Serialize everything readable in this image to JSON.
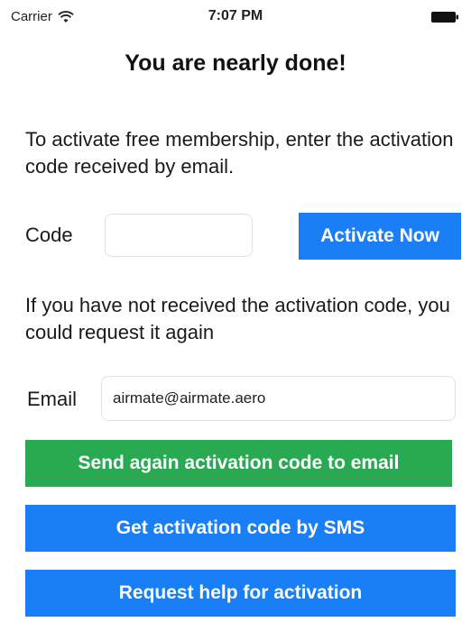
{
  "status_bar": {
    "carrier": "Carrier",
    "time": "7:07 PM",
    "wifi_icon": "wifi-icon",
    "battery_icon": "battery-icon"
  },
  "page": {
    "title": "You are nearly done!",
    "instructions": "To activate free membership, enter the activation code received by email.",
    "resend_info": "If you have not received the activation code, you could request it again"
  },
  "activation": {
    "code_label": "Code",
    "code_value": "",
    "activate_button": "Activate Now"
  },
  "email": {
    "label": "Email",
    "value": "airmate@airmate.aero"
  },
  "actions": {
    "send_email": "Send again activation code to email",
    "sms": "Get activation code by SMS",
    "help": "Request help for activation"
  },
  "colors": {
    "blue": "#1a7ef7",
    "green": "#2aa953"
  }
}
